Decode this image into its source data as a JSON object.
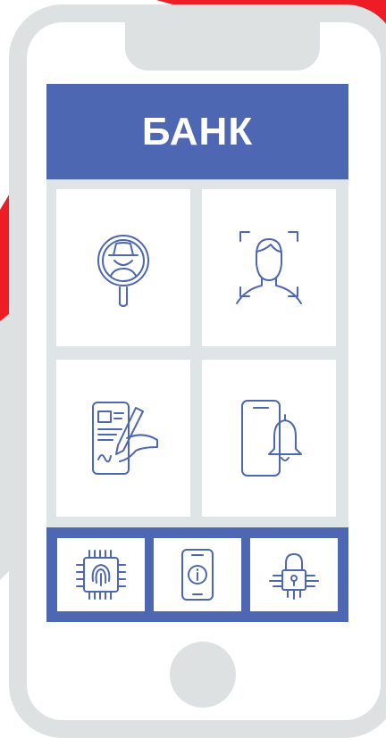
{
  "colors": {
    "primary": "#4d67b2",
    "accent_red": "#ee1c25",
    "frame_gray": "#dde1e2",
    "tile_background": "#dfe4e6"
  },
  "header": {
    "title": "БАНК"
  },
  "tiles": [
    {
      "icon": "spy-magnifier-icon"
    },
    {
      "icon": "face-scan-icon"
    },
    {
      "icon": "signature-phone-icon"
    },
    {
      "icon": "phone-notification-bell-icon"
    }
  ],
  "bottom_tiles": [
    {
      "icon": "fingerprint-chip-icon"
    },
    {
      "icon": "phone-info-icon"
    },
    {
      "icon": "circuit-lock-icon"
    }
  ]
}
